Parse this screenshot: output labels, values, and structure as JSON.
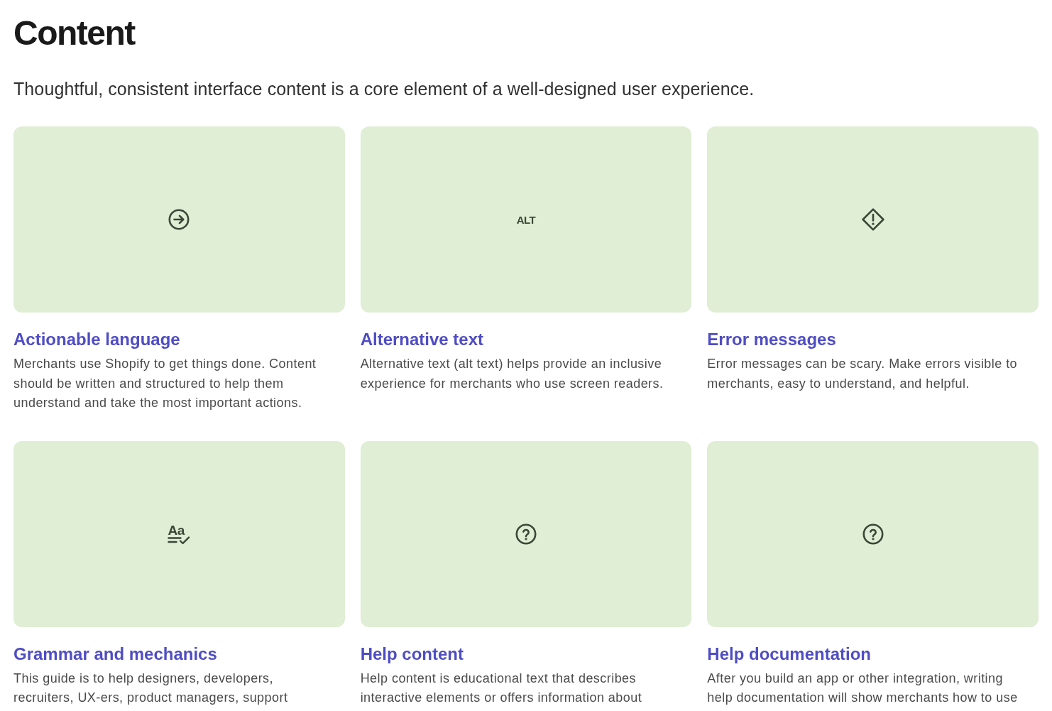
{
  "page": {
    "title": "Content",
    "intro": "Thoughtful, consistent interface content is a core element of a well-designed user experience."
  },
  "cards": [
    {
      "title": "Actionable language",
      "description": "Merchants use Shopify to get things done. Content should be written and structured to help them understand and take the most important actions.",
      "icon": {
        "kind": "arrow-circle"
      }
    },
    {
      "title": "Alternative text",
      "description": "Alternative text (alt text) helps provide an inclusive experience for merchants who use screen readers.",
      "icon": {
        "kind": "text",
        "text": "ALT"
      }
    },
    {
      "title": "Error messages",
      "description": "Error messages can be scary. Make errors visible to merchants, easy to understand, and helpful.",
      "icon": {
        "kind": "alert-diamond"
      }
    },
    {
      "title": "Grammar and mechanics",
      "description": "This guide is to help designers, developers, recruiters, UX-ers, product managers, support",
      "icon": {
        "kind": "text-check",
        "text": "Aa"
      }
    },
    {
      "title": "Help content",
      "description": "Help content is educational text that describes interactive elements or offers information about",
      "icon": {
        "kind": "question-circle"
      }
    },
    {
      "title": "Help documentation",
      "description": "After you build an app or other integration, writing help documentation will show merchants how to use",
      "icon": {
        "kind": "question-circle"
      }
    }
  ]
}
